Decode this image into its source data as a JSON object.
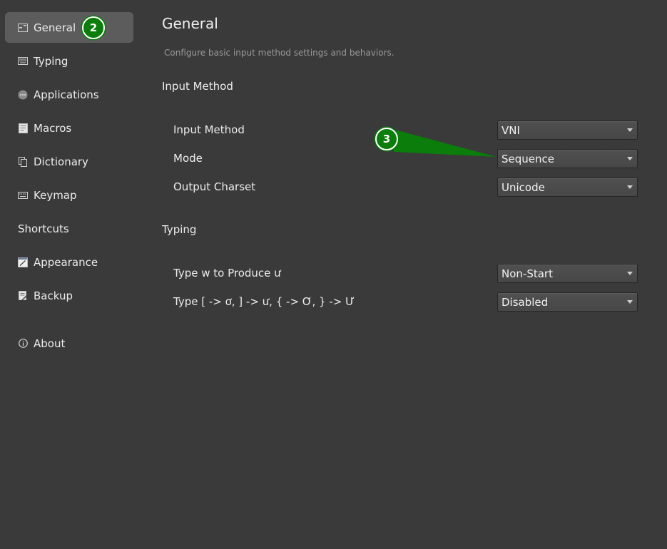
{
  "sidebar": {
    "items": [
      {
        "label": "General",
        "icon": "general-icon",
        "active": true
      },
      {
        "label": "Typing",
        "icon": "keyboard-icon"
      },
      {
        "label": "Applications",
        "icon": "applications-icon"
      },
      {
        "label": "Macros",
        "icon": "macros-icon"
      },
      {
        "label": "Dictionary",
        "icon": "dictionary-icon"
      },
      {
        "label": "Keymap",
        "icon": "keymap-icon"
      },
      {
        "label": "Shortcuts",
        "icon": ""
      },
      {
        "label": "Appearance",
        "icon": "appearance-icon"
      },
      {
        "label": "Backup",
        "icon": "backup-icon"
      },
      {
        "label": "About",
        "icon": "info-icon"
      }
    ]
  },
  "main": {
    "title": "General",
    "subtitle": "Configure basic input method settings and behaviors.",
    "sections": [
      {
        "heading": "Input Method",
        "rows": [
          {
            "label": "Input Method",
            "value": "VNI"
          },
          {
            "label": "Mode",
            "value": "Sequence"
          },
          {
            "label": "Output Charset",
            "value": "Unicode"
          }
        ]
      },
      {
        "heading": "Typing",
        "rows": [
          {
            "label": "Type w to Produce ư",
            "value": "Non-Start"
          },
          {
            "label": "Type [ -> ơ, ] -> ư, { -> Ơ, } -> Ư",
            "value": "Disabled"
          }
        ]
      }
    ]
  },
  "annotations": {
    "marker_general": "2",
    "marker_mode": "3",
    "color": "#0a7d0a"
  }
}
